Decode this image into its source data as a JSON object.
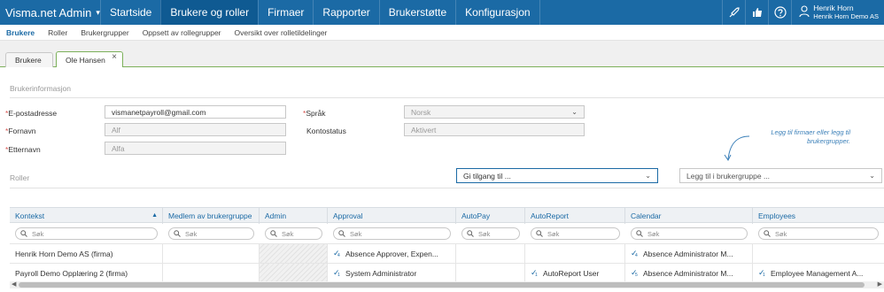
{
  "topbar": {
    "brand": "Visma.net Admin",
    "nav": [
      {
        "label": "Startside"
      },
      {
        "label": "Brukere og roller"
      },
      {
        "label": "Firmaer"
      },
      {
        "label": "Rapporter"
      },
      {
        "label": "Brukerstøtte"
      },
      {
        "label": "Konfigurasjon"
      }
    ],
    "active_nav": "Brukere og roller",
    "user_name": "Henrik Horn",
    "user_company": "Henrik Horn Demo AS",
    "icons": [
      "rocket-icon",
      "thumbs-icon",
      "help-icon",
      "user-icon"
    ]
  },
  "subnav": {
    "items": [
      {
        "label": "Brukere"
      },
      {
        "label": "Roller"
      },
      {
        "label": "Brukergrupper"
      },
      {
        "label": "Oppsett av rollegrupper"
      },
      {
        "label": "Oversikt over rolletildelinger"
      }
    ],
    "active": "Brukere"
  },
  "tabs": [
    {
      "label": "Brukere"
    },
    {
      "label": "Ole Hansen"
    }
  ],
  "user_info": {
    "section_title": "Brukerinformasjon",
    "email_label": "E-postadresse",
    "email_value": "vismanetpayroll@gmail.com",
    "firstname_label": "Fornavn",
    "firstname_value": "Alf",
    "lastname_label": "Etternavn",
    "lastname_value": "Alfa",
    "language_label": "Språk",
    "language_value": "Norsk",
    "status_label": "Kontostatus",
    "status_value": "Aktivert",
    "required_marker": "*"
  },
  "roles": {
    "section_title": "Roller",
    "grant_access_placeholder": "Gi tilgang til ...",
    "add_group_placeholder": "Legg til i brukergruppe ...",
    "hint": "Legg til firmaer eller legg til brukergrupper."
  },
  "grid": {
    "columns": [
      {
        "label": "Kontekst"
      },
      {
        "label": "Medlem av brukergruppe"
      },
      {
        "label": "Admin"
      },
      {
        "label": "Approval"
      },
      {
        "label": "AutoPay"
      },
      {
        "label": "AutoReport"
      },
      {
        "label": "Calendar"
      },
      {
        "label": "Employees"
      }
    ],
    "search_placeholder": "Søk",
    "rows": [
      {
        "context": "Henrik Horn Demo AS (firma)",
        "group": "",
        "approval": "Absence Approver, Expen...",
        "approval_count": "4",
        "autopay": "",
        "autoreport": "",
        "autoreport_count": "",
        "calendar": "Absence Administrator M...",
        "calendar_count": "4",
        "employees": "",
        "employees_count": ""
      },
      {
        "context": "Payroll Demo Opplæring 2 (firma)",
        "group": "",
        "approval": "System Administrator",
        "approval_count": "1",
        "autopay": "",
        "autoreport": "AutoReport User",
        "autoreport_count": "1",
        "calendar": "Absence Administrator M...",
        "calendar_count": "5",
        "employees": "Employee Management A...",
        "employees_count": "1"
      }
    ]
  },
  "colors": {
    "topbar": "#1b6aa5",
    "topbar_active": "#0f5a92",
    "accent": "#1b6aa5",
    "tab_border": "#7cb05a",
    "required": "#d9534f"
  }
}
